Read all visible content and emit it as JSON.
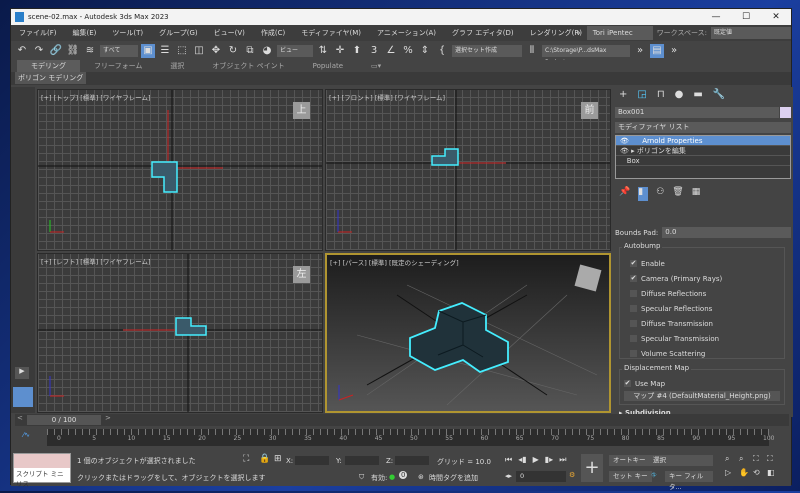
{
  "window": {
    "title": "scene-02.max - Autodesk 3ds Max 2023",
    "minimize": "—",
    "maximize": "☐",
    "close": "✕"
  },
  "menu": [
    "ファイル(F)",
    "編集(E)",
    "ツール(T)",
    "グループ(G)",
    "ビュー(V)",
    "作成(C)",
    "モディファイヤ(M)",
    "アニメーション(A)",
    "グラフ エディタ(D)",
    "レンダリング(R)"
  ],
  "user": {
    "name": "Tori iPentec",
    "workspace_label": "ワークスペース:",
    "workspace": "既定値",
    "more": "»"
  },
  "toolbar": {
    "selection_filter": "すべて",
    "ref_coord": "ビュー",
    "named_selection": "選択セット作成",
    "project_path": "C:\\Storage\\P...dsMax Project"
  },
  "ribbon": {
    "tabs": [
      "モデリング",
      "フリーフォーム",
      "選択",
      "オブジェクト ペイント",
      "Populate"
    ],
    "sub": "ポリゴン モデリング"
  },
  "viewports": [
    {
      "label": "[+] [トップ] [標準] [ワイヤフレーム]",
      "cube": "上"
    },
    {
      "label": "[+] [フロント] [標準] [ワイヤフレーム]",
      "cube": "前"
    },
    {
      "label": "[+] [レフト] [標準] [ワイヤフレーム]",
      "cube": "左"
    },
    {
      "label": "[+] [パース] [標準] [既定のシェーディング]",
      "cube": ""
    }
  ],
  "panel": {
    "object_name": "Box001",
    "modifier_list": "モディファイヤ リスト",
    "stack": [
      "Arnold Properties",
      "ポリゴンを編集",
      "Box"
    ],
    "bounds_pad_label": "Bounds Pad:",
    "bounds_pad": "0.0",
    "autobump": "Autobump",
    "autobump_items": [
      {
        "label": "Enable",
        "checked": true
      },
      {
        "label": "Camera (Primary Rays)",
        "checked": true
      },
      {
        "label": "Diffuse Reflections",
        "checked": false
      },
      {
        "label": "Specular Reflections",
        "checked": false
      },
      {
        "label": "Diffuse Transmission",
        "checked": false
      },
      {
        "label": "Specular Transmission",
        "checked": false
      },
      {
        "label": "Volume Scattering",
        "checked": false
      }
    ],
    "displacement": "Displacement Map",
    "use_map": "Use Map",
    "map_button": "マップ #4 (DefaultMaterial_Height.png)",
    "subdivision": "Subdivision"
  },
  "timeline": {
    "frame": "0 / 100",
    "ticks": [
      "0",
      "5",
      "10",
      "15",
      "20",
      "25",
      "30",
      "35",
      "40",
      "45",
      "50",
      "55",
      "60",
      "65",
      "70",
      "75",
      "80",
      "85",
      "90",
      "95",
      "100"
    ]
  },
  "status": {
    "script": "スクリプト ミニ リス",
    "selected": "1 個のオブジェクトが選択されました",
    "hint": "クリックまたはドラッグをして、オブジェクトを選択します",
    "x": "X:",
    "y": "Y:",
    "z": "Z:",
    "grid": "グリッド = 10.0",
    "enabled": "有効:",
    "add_tag": "時間タグを追加",
    "auto_key": "オートキー",
    "set_key": "セット キー",
    "sel": "選択",
    "key_filter": "キー フィルタ...",
    "frame_value": "0"
  }
}
